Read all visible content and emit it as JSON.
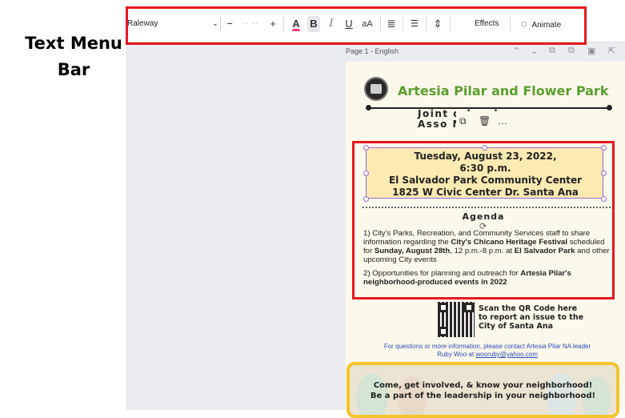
{
  "annotation": {
    "label_line1": "Text Menu",
    "label_line2": "Bar"
  },
  "toolbar": {
    "font_name": "Raleway",
    "decrease_size": "−",
    "font_size": "-- --",
    "increase_size": "+",
    "text_color_label": "A",
    "bold_label": "B",
    "italic_label": "I",
    "underline_label": "U",
    "case_label": "aA",
    "align_icon": "≣",
    "list_icon": "☰",
    "spacing_icon": "⇕",
    "effects_label": "Effects",
    "animate_label": "Animate",
    "animate_icon": "◌"
  },
  "page_header": {
    "label": "Page 1 - English",
    "icons": [
      "chevron-up-icon",
      "chevron-down-icon",
      "duplicate-page-icon",
      "copy-icon",
      "delete-icon",
      "add-page-icon"
    ]
  },
  "flyer": {
    "title": "Artesia Pilar and Flower Park",
    "subtitle_line1": "Joint  orhood",
    "subtitle_line2": "Asso  Meeting",
    "float_menu": {
      "duplicate": "⧉",
      "delete": "🗑",
      "more": "…"
    },
    "event": {
      "line1": "Tuesday, August 23, 2022,",
      "line2": "6:30 p.m.",
      "line3": "El Salvador Park Community Center",
      "line4": "1825 W Civic Center Dr. Santa Ana"
    },
    "agenda_title": "Agenda",
    "agenda_item1": {
      "p1": "1) City's Parks, Recreation, and Community Services staff to share information regarding the ",
      "b1": "City's Chicano Heritage Festival",
      "p2": " scheduled for ",
      "b2": "Sunday, August 28th",
      "p3": ", 12 p.m.-8 p.m. at ",
      "b3": "El Salvador Park",
      "p4": " and other upcoming City events"
    },
    "agenda_item2": {
      "p1": "2) Opportunities for planning and outreach for ",
      "b1": "Artesia Pilar's neighborhood-produced events in 2022"
    },
    "qr_text": {
      "line1": "Scan the QR Code here",
      "line2": "to report an issue to the",
      "line3": "City of Santa Ana"
    },
    "contact": {
      "line1": "For questions or more information, please contact Artesia Pilar NA leader",
      "line2_prefix": "Ruby Woo at ",
      "email": "wooruby@yahoo.com"
    },
    "banner": {
      "line1": "Come, get involved, & know your neighborhood!",
      "line2": "Be a part of the leadership in your neighborhood!"
    }
  },
  "colors": {
    "highlight": "#e5171f",
    "title_green": "#5a9e2f",
    "selection_purple": "#9b6bd8",
    "event_fill": "#fde9b2",
    "banner_border": "#f3c42d",
    "link_blue": "#2a4bb5"
  }
}
